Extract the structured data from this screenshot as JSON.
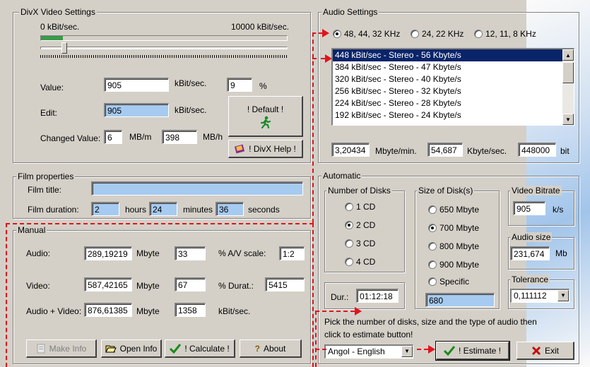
{
  "divx": {
    "title": "DivX Video Settings",
    "min_label": "0 kBit/sec.",
    "max_label": "10000 kBit/sec.",
    "value_label": "Value:",
    "value": "905",
    "unit1": "kBit/sec.",
    "percent_value": "9",
    "percent_sign": "%",
    "edit_label": "Edit:",
    "edit_value": "905",
    "unit2": "kBit/sec.",
    "changed_label": "Changed Value:",
    "changed_mb": "6",
    "mbm": "MB/m",
    "changed_mbh": "398",
    "mbh": "MB/h",
    "default_btn": "! Default !",
    "help_btn": "! DivX Help !"
  },
  "film": {
    "title": "Film properties",
    "title_label": "Film title:",
    "title_value": "",
    "duration_label": "Film duration:",
    "hours": "2",
    "hours_label": "hours",
    "minutes": "24",
    "minutes_label": "minutes",
    "seconds": "36",
    "seconds_label": "seconds"
  },
  "manual": {
    "title": "Manual",
    "audio_label": "Audio:",
    "audio_mb": "289,19219",
    "audio_unit": "Mbyte",
    "audio_kb": "33",
    "av_label": "%  A/V scale:",
    "av_value": "1:2",
    "video_label": "Video:",
    "video_mb": "587,42165",
    "video_unit": "Mbyte",
    "video_kb": "67",
    "durat_label": "%  Durat.:",
    "durat_value": "5415",
    "av_total_label": "Audio + Video:",
    "total_mb": "876,61385",
    "total_unit": "Mbyte",
    "total_kb": "1358",
    "kbit_label": "kBit/sec.",
    "make_info": "Make Info",
    "open_info": "Open Info",
    "calculate": "! Calculate !",
    "about": "About"
  },
  "audio": {
    "title": "Audio Settings",
    "rate_options": [
      "48, 44, 32 KHz",
      "24, 22 KHz",
      "12, 11, 8 KHz"
    ],
    "selected_rate": 0,
    "list": [
      "448 kBit/sec - Stereo - 56 Kbyte/s",
      "384 kBit/sec - Stereo - 47 Kbyte/s",
      "320 kBit/sec - Stereo - 40 Kbyte/s",
      "256 kBit/sec - Stereo - 32 Kbyte/s",
      "224 kBit/sec - Stereo - 28 Kbyte/s",
      "192 kBit/sec - Stereo - 24 Kbyte/s"
    ],
    "mbyte_min": "3,20434",
    "mbyte_min_label": "Mbyte/min.",
    "kbyte_sec": "54,687",
    "kbyte_sec_label": "Kbyte/sec.",
    "bit": "448000",
    "bit_label": "bit"
  },
  "automatic": {
    "title": "Automatic",
    "disks_title": "Number of Disks",
    "disks": [
      "1 CD",
      "2 CD",
      "3 CD",
      "4 CD"
    ],
    "selected_disk": 1,
    "size_title": "Size of Disk(s)",
    "sizes": [
      "650 Mbyte",
      "700 Mbyte",
      "800 Mbyte",
      "900 Mbyte",
      "Specific"
    ],
    "selected_size": 1,
    "specific_value": "680",
    "dur_label": "Dur.:",
    "dur_value": "01:12:18",
    "video_bitrate_title": "Video Bitrate",
    "video_bitrate": "905",
    "video_bitrate_unit": "k/s",
    "audio_size_title": "Audio size",
    "audio_size": "231,674",
    "audio_size_unit": "Mb",
    "tolerance_title": "Tolerance",
    "tolerance": "0,111112",
    "hint_line1": "Pick the number of disks, size and the type of audio then",
    "hint_line2": "click to estimate button!",
    "language": "Angol - English",
    "estimate": "! Estimate !",
    "exit": "Exit"
  },
  "colors": {
    "accent_red": "#e0141e",
    "selection": "#0a246a",
    "field_cyan": "#a6caf0"
  }
}
